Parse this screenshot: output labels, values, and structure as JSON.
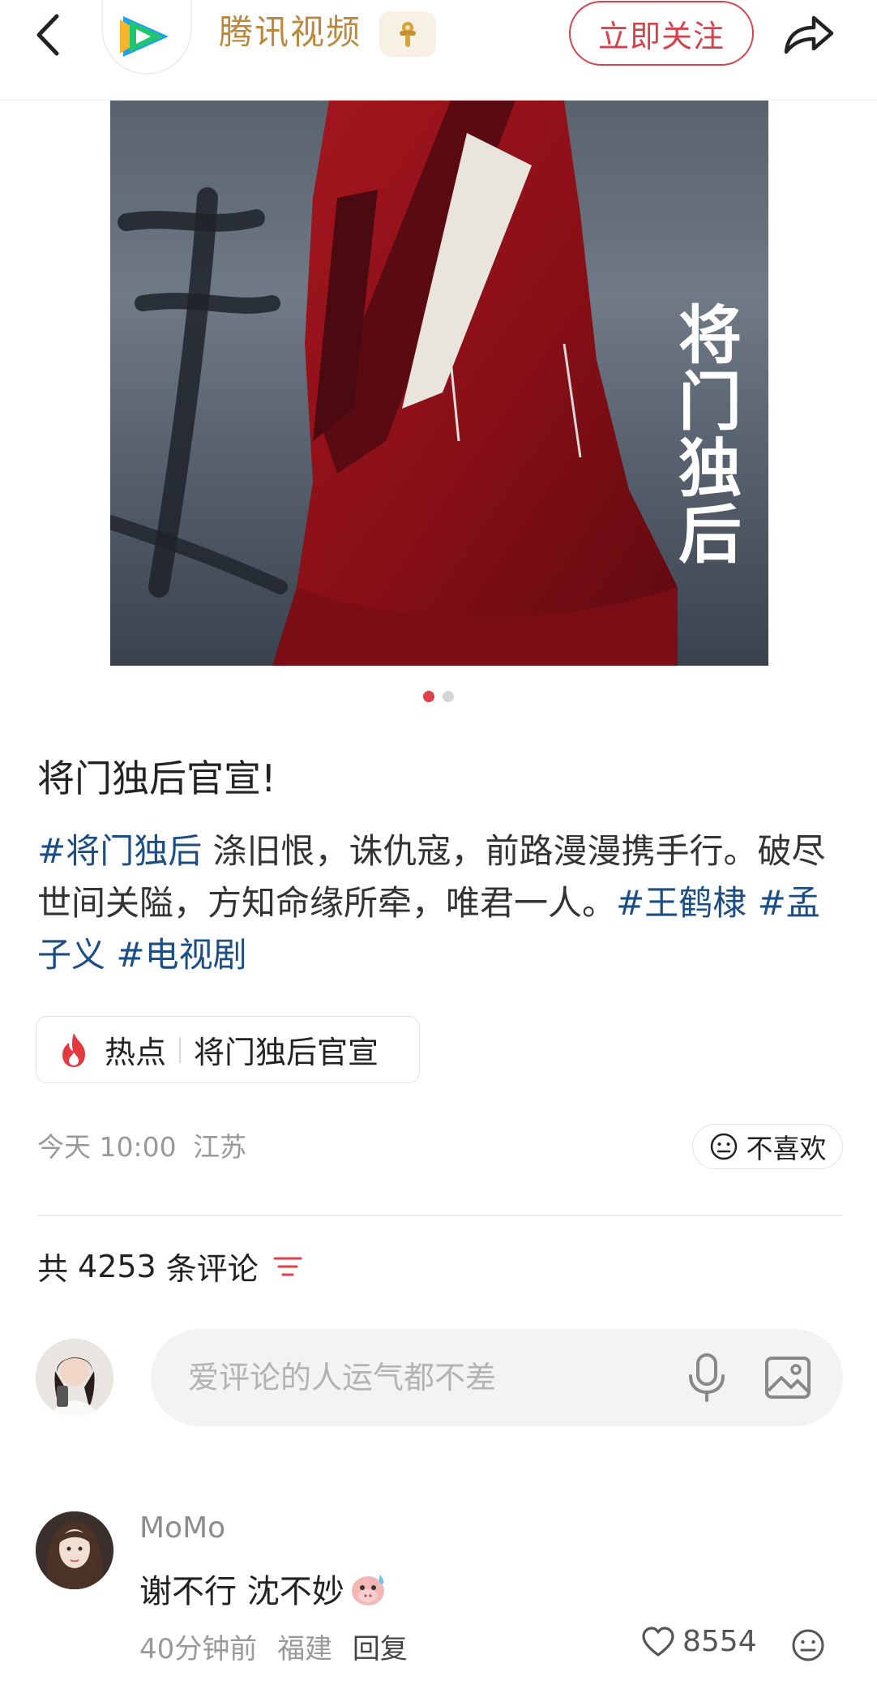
{
  "header": {
    "channel_name": "腾讯视频",
    "follow_label": "立即关注",
    "brand_color": "#d7424a",
    "name_color": "#b8893e"
  },
  "poster": {
    "title_text": "将门独后"
  },
  "carousel": {
    "total": 2,
    "active": 1
  },
  "post": {
    "title": "将门独后官宣!",
    "body_segments": [
      {
        "type": "tag",
        "text": "#将门独后"
      },
      {
        "type": "text",
        "text": " 涤旧恨，诛仇寇，前路漫漫携手行。破尽世间关隘，方知命缘所牵，唯君一人。"
      },
      {
        "type": "tag",
        "text": "#王鹤棣"
      },
      {
        "type": "text",
        "text": " "
      },
      {
        "type": "tag",
        "text": "#孟子义"
      },
      {
        "type": "text",
        "text": " "
      },
      {
        "type": "tag",
        "text": "#电视剧"
      }
    ],
    "hot": {
      "label": "热点",
      "topic": "将门独后官宣"
    },
    "time": "今天 10:00",
    "location": "江苏",
    "dislike_label": "不喜欢"
  },
  "comments": {
    "prefix": "共",
    "count": "4253",
    "suffix": "条评论",
    "input_placeholder": "爱评论的人运气都不差",
    "items": [
      {
        "user": "MoMo",
        "text": "谢不行 沈不妙",
        "time": "40分钟前",
        "location": "福建",
        "reply_label": "回复",
        "likes": "8554"
      }
    ]
  },
  "icons": {
    "back": "back-icon",
    "share": "share-icon",
    "fire": "fire-icon",
    "sort": "sort-icon",
    "mic": "mic-icon",
    "image": "image-icon",
    "like": "heart-icon",
    "emoji": "emoji-icon"
  }
}
